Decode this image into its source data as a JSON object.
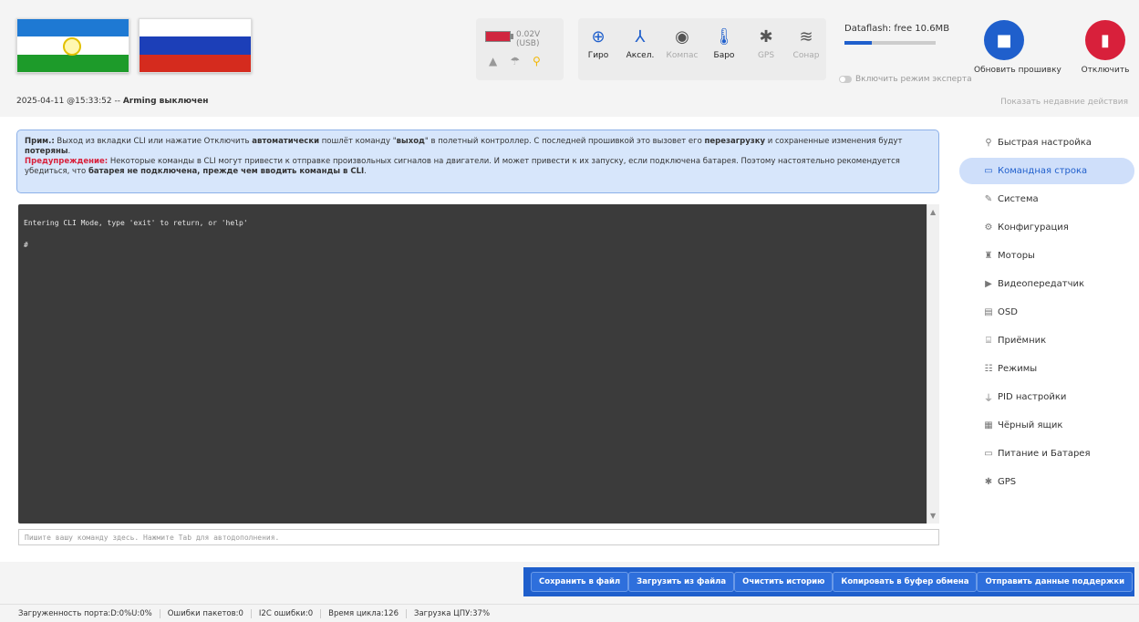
{
  "header": {
    "battery": {
      "text": "0.02V (USB)",
      "color": "#d0263f"
    },
    "sensors": [
      {
        "name": "gyro",
        "label": "Гиро",
        "icon": "globe-icon",
        "active": true
      },
      {
        "name": "accel",
        "label": "Аксел.",
        "icon": "axes-icon",
        "active": true
      },
      {
        "name": "compass",
        "label": "Компас",
        "icon": "compass-icon",
        "active": false
      },
      {
        "name": "baro",
        "label": "Баро",
        "icon": "thermometer-icon",
        "active": true
      },
      {
        "name": "gps",
        "label": "GPS",
        "icon": "satellite-icon",
        "active": false
      },
      {
        "name": "sonar",
        "label": "Сонар",
        "icon": "sonar-icon",
        "active": false
      }
    ],
    "dataflash": {
      "text": "Dataflash: free 10.6MB",
      "used_fraction": 0.3
    },
    "expert_mode_label": "Включить режим эксперта",
    "update_firmware_label": "Обновить прошивку",
    "disconnect_label": "Отключить",
    "timestamp": "2025-04-11 @15:33:52 -- ",
    "arming_status": "Arming выключен",
    "recent_actions_label": "Показать недавние действия"
  },
  "note": {
    "prefix": "Прим.:",
    "t1": " Выход из вкладки CLI или нажатие Отключить ",
    "b1": "автоматически",
    "t2": " пошлёт команду \"",
    "b2": "выход",
    "t3": "\" в полетный контроллер. С последней прошивкой это вызовет его ",
    "b3": "перезагрузку",
    "t4": " и сохраненные изменения будут ",
    "b4": "потеряны",
    "t5": ".",
    "warn_prefix": "Предупреждение:",
    "w1": " Некоторые команды в CLI могут привести к отправке произвольных сигналов на двигатели. И может привести к их запуску, если подключена батарея. Поэтому настоятельно рекомендуется убедиться, что ",
    "wb": "батарея не подключена, прежде чем вводить команды в CLI",
    "w2": "."
  },
  "console": {
    "text": "Entering CLI Mode, type 'exit' to return, or 'help'",
    "prompt": "#"
  },
  "input": {
    "placeholder": "Пишите вашу команду здесь. Нажмите Tab для автодополнения."
  },
  "sidebar": {
    "items": [
      {
        "label": "Быстрая настройка",
        "icon": "wrench-icon"
      },
      {
        "label": "Командная строка",
        "icon": "terminal-icon"
      },
      {
        "label": "Система",
        "icon": "wrench-icon"
      },
      {
        "label": "Конфигурация",
        "icon": "gear-icon"
      },
      {
        "label": "Моторы",
        "icon": "motor-icon"
      },
      {
        "label": "Видеопередатчик",
        "icon": "video-icon"
      },
      {
        "label": "OSD",
        "icon": "osd-icon"
      },
      {
        "label": "Приёмник",
        "icon": "receiver-icon"
      },
      {
        "label": "Режимы",
        "icon": "modes-icon"
      },
      {
        "label": "PID настройки",
        "icon": "pid-icon"
      },
      {
        "label": "Чёрный ящик",
        "icon": "blackbox-icon"
      },
      {
        "label": "Питание и Батарея",
        "icon": "battery-icon"
      },
      {
        "label": "GPS",
        "icon": "satellite-icon"
      }
    ],
    "active_index": 1
  },
  "actions": {
    "save_file": "Сохранить в файл",
    "load_file": "Загрузить из файла",
    "clear_history": "Очистить историю",
    "copy_clipboard": "Копировать в буфер обмена",
    "send_support": "Отправить данные поддержки"
  },
  "status": {
    "port_load": "Загруженность порта:D:0%U:0%",
    "packet_errors": "Ошибки пакетов:0",
    "i2c_errors": "I2C ошибки:0",
    "cycle_time": "Время цикла:126",
    "cpu_load": "Загрузка ЦПУ:37%"
  },
  "colors": {
    "accent": "#1f5fcc",
    "danger": "#d8203b",
    "note_bg": "#d7e6fb",
    "console_bg": "#3b3b3b"
  }
}
